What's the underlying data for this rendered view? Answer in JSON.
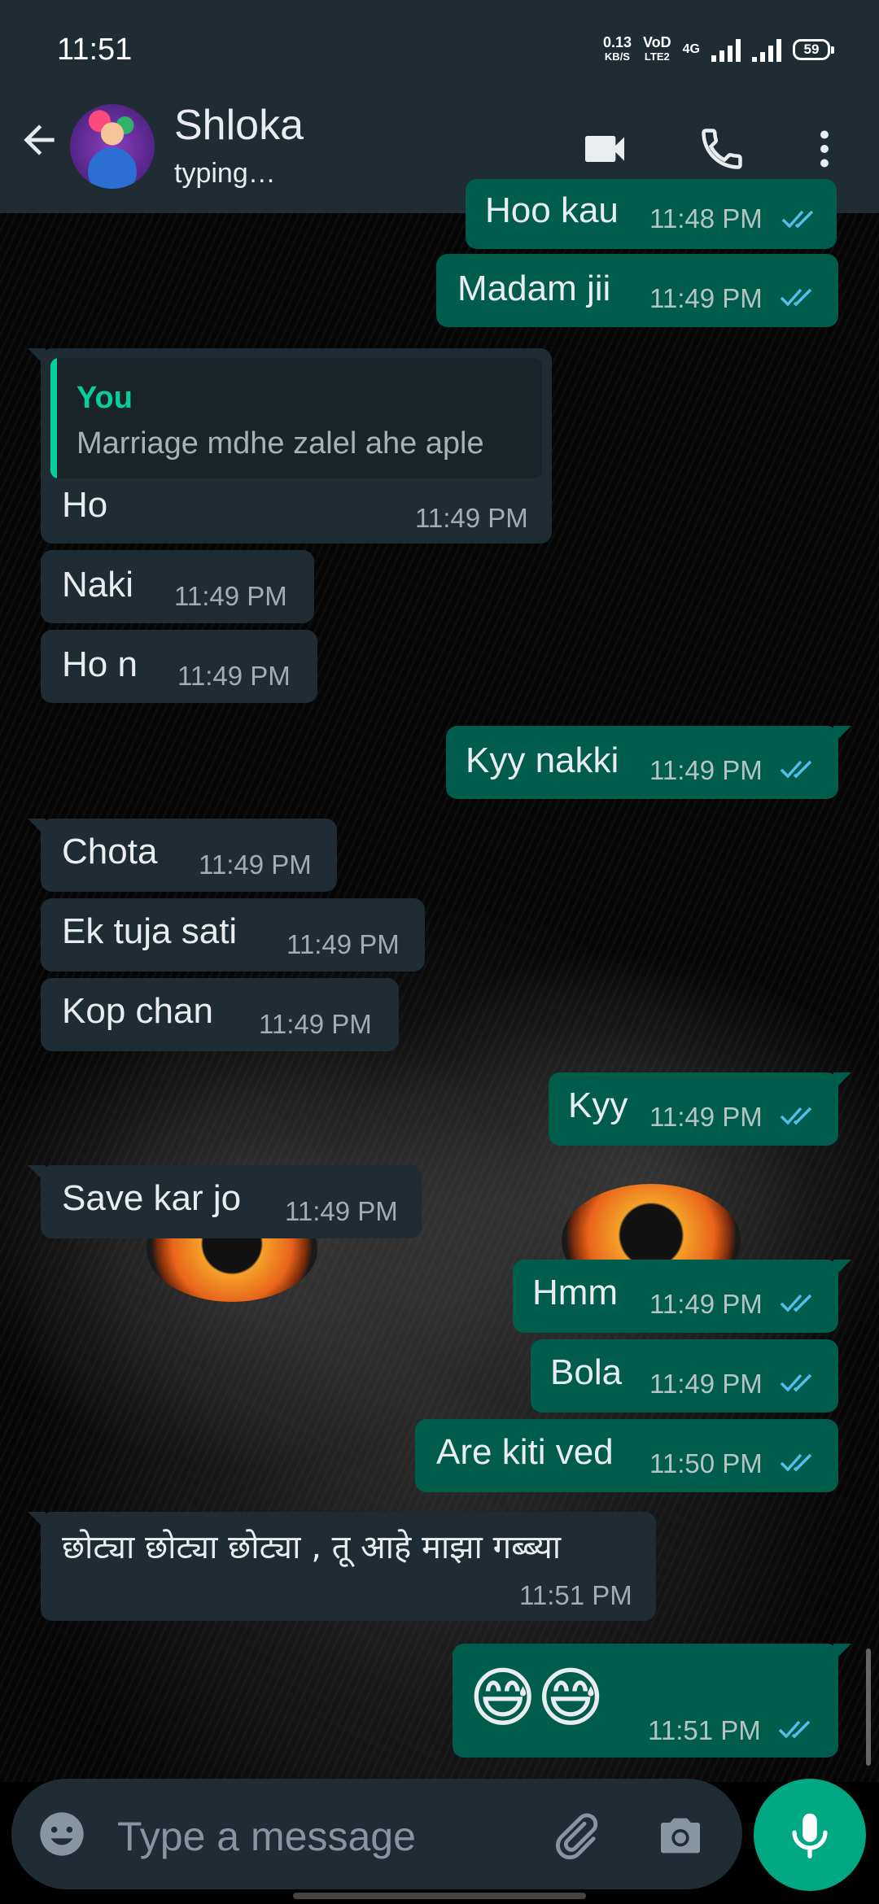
{
  "status_bar": {
    "time": "11:51",
    "net_speed": "0.13",
    "net_unit": "KB/S",
    "volte_top": "VoD",
    "volte_bottom": "LTE2",
    "network": "4G",
    "battery": "59"
  },
  "header": {
    "contact_name": "Shloka",
    "contact_status": "typing…",
    "back_icon": "arrow-left-icon",
    "video_icon": "video-camera-icon",
    "call_icon": "phone-icon",
    "menu_icon": "more-vertical-icon"
  },
  "messages": [
    {
      "dir": "out",
      "text": "Hoo kau",
      "time": "11:48 PM",
      "read": true
    },
    {
      "dir": "out",
      "text": "Madam jii",
      "time": "11:49 PM",
      "read": true
    },
    {
      "dir": "in",
      "quote_author": "You",
      "quote_text": "Marriage mdhe zalel ahe aple",
      "text": "Ho",
      "time": "11:49 PM"
    },
    {
      "dir": "in",
      "text": "Naki",
      "time": "11:49 PM"
    },
    {
      "dir": "in",
      "text": "Ho n",
      "time": "11:49 PM"
    },
    {
      "dir": "out",
      "text": "Kyy nakki",
      "time": "11:49 PM",
      "read": true
    },
    {
      "dir": "in",
      "text": "Chota",
      "time": "11:49 PM"
    },
    {
      "dir": "in",
      "text": "Ek tuja sati",
      "time": "11:49 PM"
    },
    {
      "dir": "in",
      "text": "Kop chan",
      "time": "11:49 PM"
    },
    {
      "dir": "out",
      "text": "Kyy",
      "time": "11:49 PM",
      "read": true
    },
    {
      "dir": "in",
      "text": "Save kar jo",
      "time": "11:49 PM"
    },
    {
      "dir": "out",
      "text": "Hmm",
      "time": "11:49 PM",
      "read": true
    },
    {
      "dir": "out",
      "text": "Bola",
      "time": "11:49 PM",
      "read": true
    },
    {
      "dir": "out",
      "text": "Are kiti ved",
      "time": "11:50 PM",
      "read": true
    },
    {
      "dir": "in",
      "text": "छोट्या छोट्या छोट्या , तू आहे माझा गब्ब्या",
      "time": "11:51 PM"
    },
    {
      "dir": "out",
      "text": "😅😅",
      "time": "11:51 PM",
      "read": true
    }
  ],
  "composer": {
    "placeholder": "Type a message",
    "emoji_icon": "emoji-icon",
    "attach_icon": "paperclip-icon",
    "camera_icon": "camera-icon",
    "mic_icon": "microphone-icon"
  },
  "colors": {
    "header_bg": "#1f2c34",
    "incoming_bubble": "#202c33",
    "outgoing_bubble": "#005c4b",
    "accent": "#00a884",
    "read_tick": "#53bdeb"
  }
}
